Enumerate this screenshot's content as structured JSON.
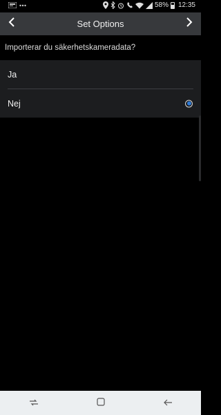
{
  "status_bar": {
    "battery": "58%",
    "time": "12:35"
  },
  "header": {
    "title": "Set Options"
  },
  "question": "Importerar du säkerhetskameradata?",
  "options": [
    {
      "label": "Ja",
      "selected": false
    },
    {
      "label": "Nej",
      "selected": true
    }
  ],
  "colors": {
    "header_bg": "#37393c",
    "option_bg": "#1c1d1f",
    "radio_selected": "#2e7ad6",
    "nav_bar_bg": "#eceff1"
  },
  "icons": {
    "back": "chevron-left-icon",
    "forward": "chevron-right-icon",
    "nav_recents": "recents-icon",
    "nav_home": "home-icon",
    "nav_back": "back-arrow-icon"
  }
}
